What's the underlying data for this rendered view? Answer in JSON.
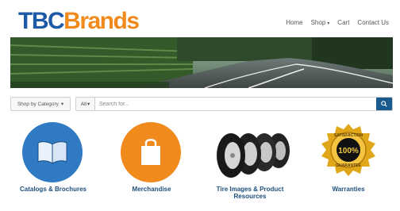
{
  "brand": {
    "part1": "TBC",
    "part2": "Brands"
  },
  "nav": {
    "home": "Home",
    "shop": "Shop",
    "cart": "Cart",
    "contact": "Contact Us"
  },
  "search": {
    "category_label": "Shop by Category",
    "scope_label": "All",
    "placeholder": "Search for..."
  },
  "tiles": [
    {
      "label": "Catalogs & Brochures",
      "icon": "book-icon"
    },
    {
      "label": "Merchandise",
      "icon": "shopping-bag-icon"
    },
    {
      "label": "Tire Images & Product Resources",
      "icon": "tires-icon"
    },
    {
      "label": "Warranties",
      "icon": "satisfaction-seal-icon"
    }
  ],
  "seal": {
    "line1": "SATISFACTION",
    "line2": "100%",
    "line3": "GUARANTEE"
  },
  "colors": {
    "brand_blue": "#1c5aa8",
    "brand_orange": "#f08a1c",
    "link_blue": "#1d4f7e",
    "search_button": "#1a5b8f"
  }
}
